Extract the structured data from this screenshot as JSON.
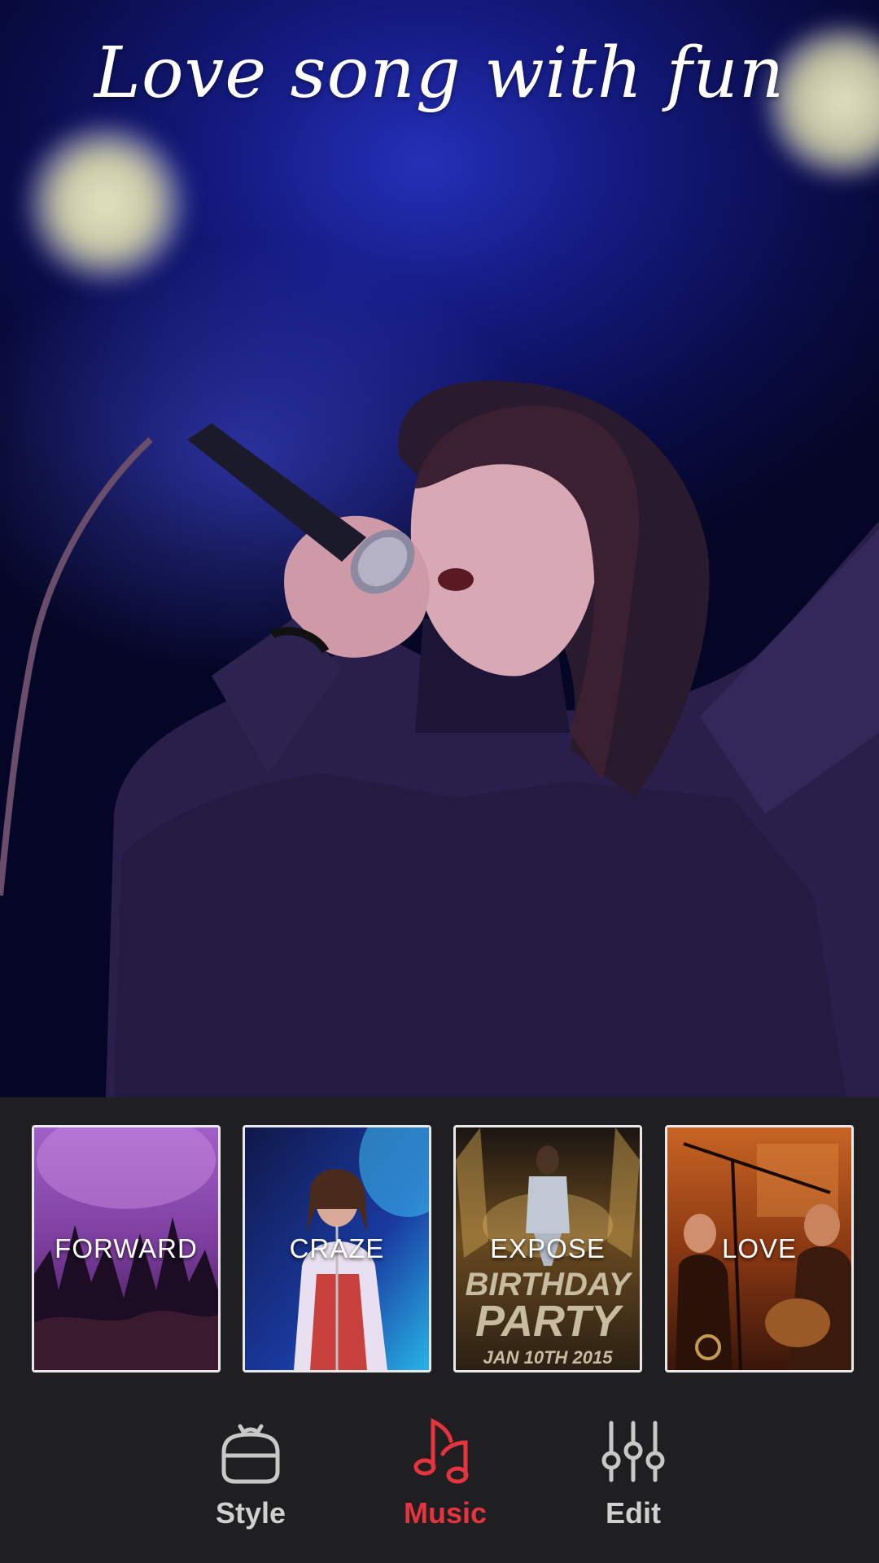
{
  "hero": {
    "title": "Love song with fun"
  },
  "themes": [
    {
      "label": "FORWARD"
    },
    {
      "label": "CRAZE"
    },
    {
      "label": "EXPOSE"
    },
    {
      "label": "LOVE"
    }
  ],
  "thumbnail_text": {
    "expose_poster_line1": "BIRTHDAY",
    "expose_poster_line2": "PARTY",
    "expose_poster_date": "JAN 10TH 2015"
  },
  "nav": {
    "items": [
      {
        "label": "Style",
        "icon": "purse-icon",
        "active": false
      },
      {
        "label": "Music",
        "icon": "music-notes-icon",
        "active": true
      },
      {
        "label": "Edit",
        "icon": "sliders-icon",
        "active": false
      }
    ]
  },
  "colors": {
    "background": "#1f1f22",
    "active_tab": "#e5343d",
    "inactive_tab": "#d0d0d0",
    "thumb_border": "#e8e8e8"
  }
}
